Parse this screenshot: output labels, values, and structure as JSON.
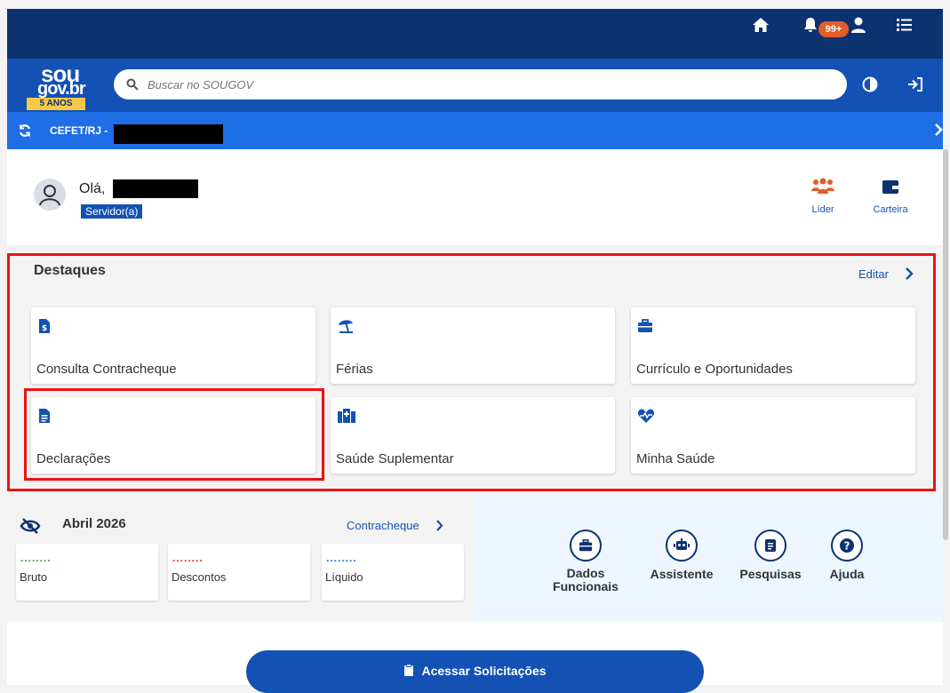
{
  "header": {
    "notifications_badge": "99+",
    "icons": [
      "home-icon",
      "bell-icon",
      "user-icon",
      "menu-list-icon",
      "contrast-icon",
      "login-icon"
    ]
  },
  "logo": {
    "line1": "sou",
    "line2": "gov.br",
    "anniversary": "5 ANOS"
  },
  "search": {
    "placeholder": "Buscar no SOUGOV"
  },
  "org": {
    "label": "CEFET/RJ -"
  },
  "user": {
    "greeting": "Olá,",
    "role": "Servidor(a)"
  },
  "quick_links": [
    {
      "label": "Líder",
      "icon": "team-icon"
    },
    {
      "label": "Carteira",
      "icon": "wallet-icon"
    }
  ],
  "highlights": {
    "title": "Destaques",
    "edit_label": "Editar",
    "tiles": [
      {
        "label": "Consulta Contracheque",
        "icon": "paycheck-document-icon"
      },
      {
        "label": "Férias",
        "icon": "beach-umbrella-icon"
      },
      {
        "label": "Currículo e Oportunidades",
        "icon": "briefcase-icon"
      },
      {
        "label": "Declarações",
        "icon": "document-lines-icon"
      },
      {
        "label": "Saúde Suplementar",
        "icon": "hospital-icon"
      },
      {
        "label": "Minha Saúde",
        "icon": "heart-pulse-icon"
      }
    ]
  },
  "paycheck": {
    "month": "Abril 2026",
    "link_label": "Contracheque",
    "cards": [
      {
        "label": "Bruto",
        "masked": "........",
        "color": "#2e9f3b"
      },
      {
        "label": "Descontos",
        "masked": "........",
        "color": "#e02b2b"
      },
      {
        "label": "Líquido",
        "masked": "........",
        "color": "#1e6ee6"
      }
    ]
  },
  "actions": [
    {
      "label": "Dados Funcionais",
      "icon": "briefcase-icon"
    },
    {
      "label": "Assistente",
      "icon": "robot-icon"
    },
    {
      "label": "Pesquisas",
      "icon": "survey-icon"
    },
    {
      "label": "Ajuda",
      "icon": "help-icon"
    }
  ],
  "primary_button": {
    "label": "Acessar Solicitações",
    "icon": "clipboard-icon"
  },
  "colors": {
    "navbar": "#0c326f",
    "search_bar": "#1351b4",
    "org_bar": "#1e6ee6",
    "accent_orange": "#e15d29",
    "highlight_outline": "#e11111",
    "link_blue": "#1351b4"
  }
}
